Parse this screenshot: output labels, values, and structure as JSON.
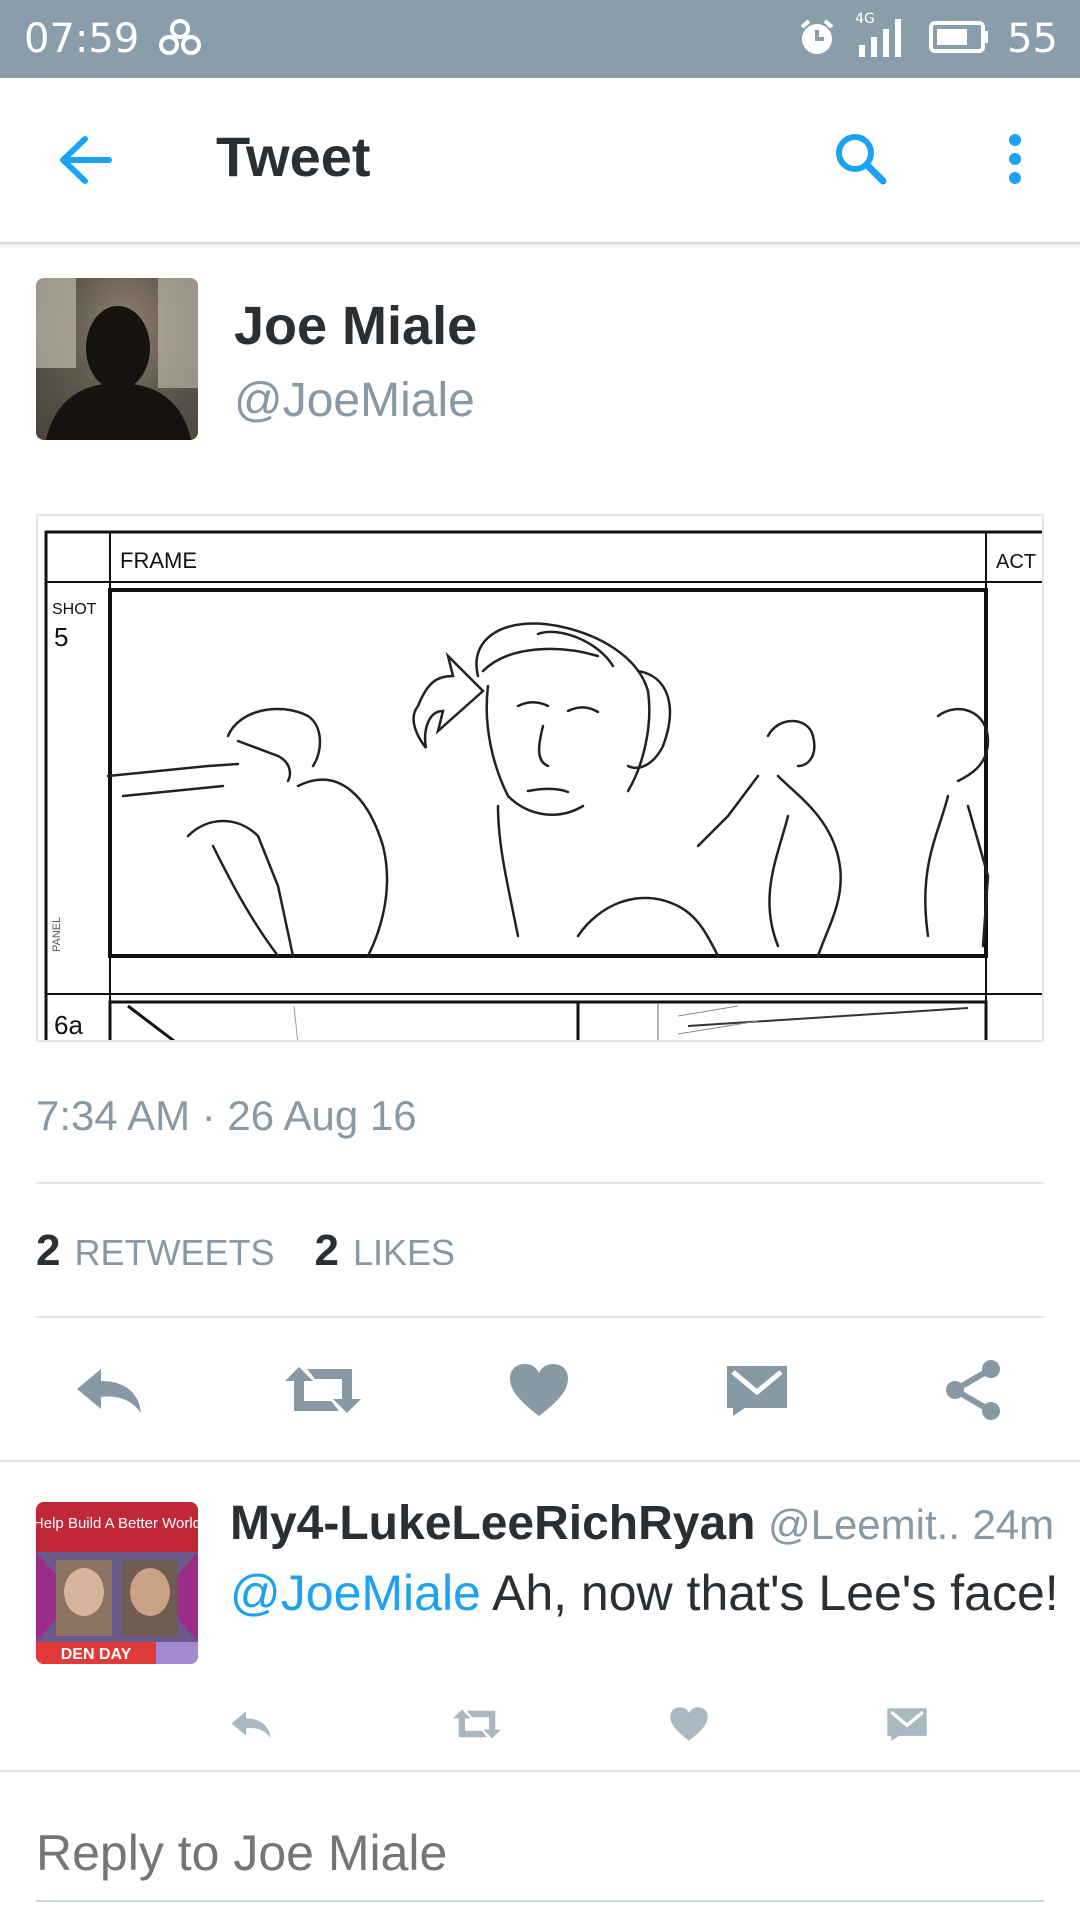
{
  "status_bar": {
    "time": "07:59",
    "network": "4G",
    "battery": "55"
  },
  "app_bar": {
    "title": "Tweet"
  },
  "tweet": {
    "author_name": "Joe Miale",
    "author_handle": "@JoeMiale",
    "media": {
      "frame_label": "FRAME",
      "act_label": "ACT",
      "shot_label": "SHOT",
      "shot_number": "5",
      "panel_label": "PANEL",
      "next_panel": "6a"
    },
    "timestamp": "7:34 AM · 26 Aug 16",
    "retweets_count": "2",
    "retweets_label": "RETWEETS",
    "likes_count": "2",
    "likes_label": "LIKES"
  },
  "reply": {
    "name": "My4-LukeLeeRichRyan",
    "handle": "@Leemit..",
    "time": "24m",
    "mention": "@JoeMiale",
    "text": " Ah, now that's Lee's face!",
    "avatar_text_top": "Help Build A Better World",
    "avatar_text_bottom": "DEN DAY"
  },
  "compose": {
    "placeholder": "Reply to Joe Miale"
  },
  "colors": {
    "status_bar": "#8a9dab",
    "accent": "#1da1f2",
    "icon_gray": "#8899a6",
    "text_dark": "#292f33"
  }
}
